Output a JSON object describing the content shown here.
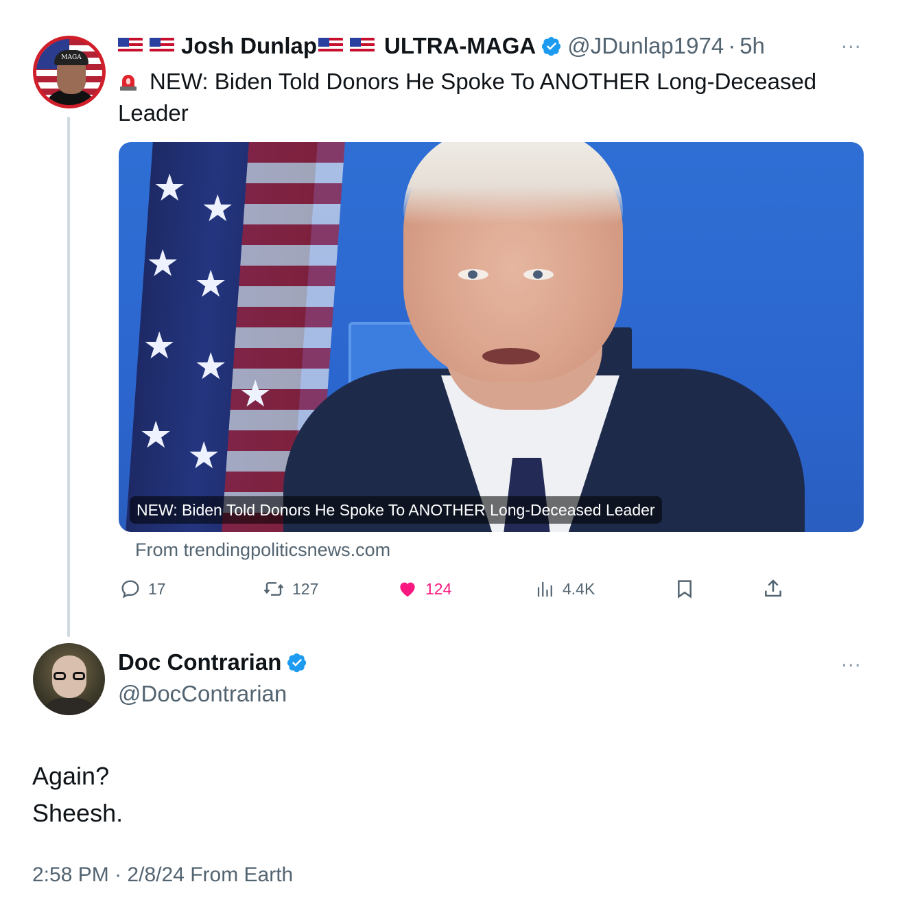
{
  "original_tweet": {
    "display_name_first": "Josh Dunlap",
    "display_name_second": "ULTRA-MAGA",
    "handle": "@JDunlap1974",
    "time_separator": "·",
    "time": "5h",
    "more": "···",
    "text": "NEW: Biden Told Donors He Spoke To ANOTHER Long-Deceased Leader",
    "avatar_hat_text": "MAGA",
    "card": {
      "caption": "NEW: Biden Told Donors He Spoke To ANOTHER Long-Deceased Leader",
      "source": "From trendingpoliticsnews.com"
    },
    "actions": {
      "replies": "17",
      "retweets": "127",
      "likes": "124",
      "views": "4.4K"
    },
    "icons": {
      "siren": "siren-emoji-icon",
      "flag": "us-flag-emoji-icon",
      "verified": "verified-badge-icon",
      "reply": "reply-icon",
      "retweet": "retweet-icon",
      "like": "heart-icon",
      "views": "views-icon",
      "bookmark": "bookmark-icon",
      "share": "share-icon"
    },
    "colors": {
      "like_active": "#f91880",
      "verified": "#1d9bf0",
      "muted": "#536471"
    }
  },
  "reply_tweet": {
    "display_name": "Doc Contrarian",
    "handle": "@DocContrarian",
    "more": "···",
    "text_line1": "Again?",
    "text_line2": "Sheesh.",
    "time": "2:58 PM",
    "separator": "·",
    "date": "2/8/24",
    "source": "From Earth"
  }
}
